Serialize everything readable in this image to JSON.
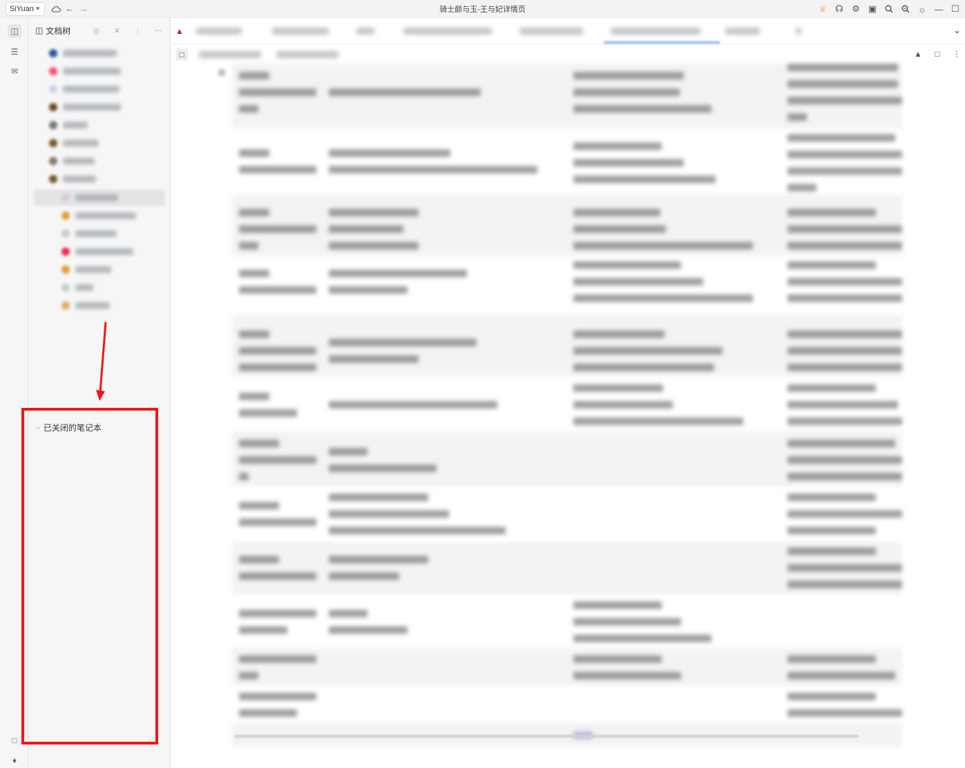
{
  "app": {
    "logo_label": "SiYuan",
    "window_title": "骑士颜与玉-王与妃详情页"
  },
  "sidebar": {
    "title": "文档树",
    "closed_notebooks_label": "已关闭的笔记本"
  },
  "colors": {
    "highlight_box": "#f21515",
    "tab_active": "#4a7cf0",
    "sidebar_bg": "#f6f6f6"
  },
  "icons": {
    "window_controls": [
      "crown-icon",
      "graph-icon",
      "plugin-icon",
      "sync-icon",
      "search-icon",
      "zoom-icon",
      "theme-icon",
      "minimize-icon",
      "maximize-icon"
    ]
  }
}
